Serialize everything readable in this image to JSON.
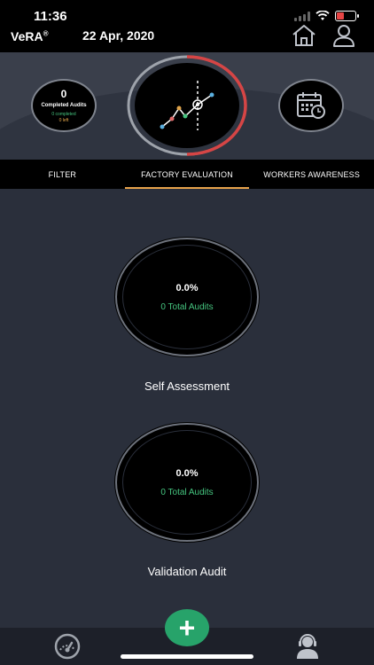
{
  "status_bar": {
    "time": "11:36"
  },
  "header": {
    "app_name": "VeRA",
    "trademark": "®",
    "date": "22 Apr, 2020"
  },
  "audits_summary": {
    "count": "0",
    "label": "Completed Audits",
    "completed": "0 completed",
    "left": "0 left"
  },
  "tabs": [
    {
      "label": "FILTER",
      "active": false
    },
    {
      "label": "FACTORY EVALUATION",
      "active": true
    },
    {
      "label": "WORKERS AWARENESS",
      "active": false
    }
  ],
  "results": [
    {
      "percent": "0.0%",
      "total": "0 Total Audits",
      "title": "Self Assessment"
    },
    {
      "percent": "0.0%",
      "total": "0 Total Audits",
      "title": "Validation Audit"
    }
  ],
  "fab": {
    "label": "+"
  },
  "icons": {
    "home": "home-icon",
    "user": "user-icon",
    "calendar": "calendar-clock-icon",
    "chart": "line-chart-icon",
    "dashboard": "gauge-icon",
    "support": "support-agent-icon"
  },
  "colors": {
    "accent_green": "#45c47f",
    "accent_orange": "#e8a34b",
    "ring_red": "#d64545",
    "fab_green": "#27a36a"
  }
}
